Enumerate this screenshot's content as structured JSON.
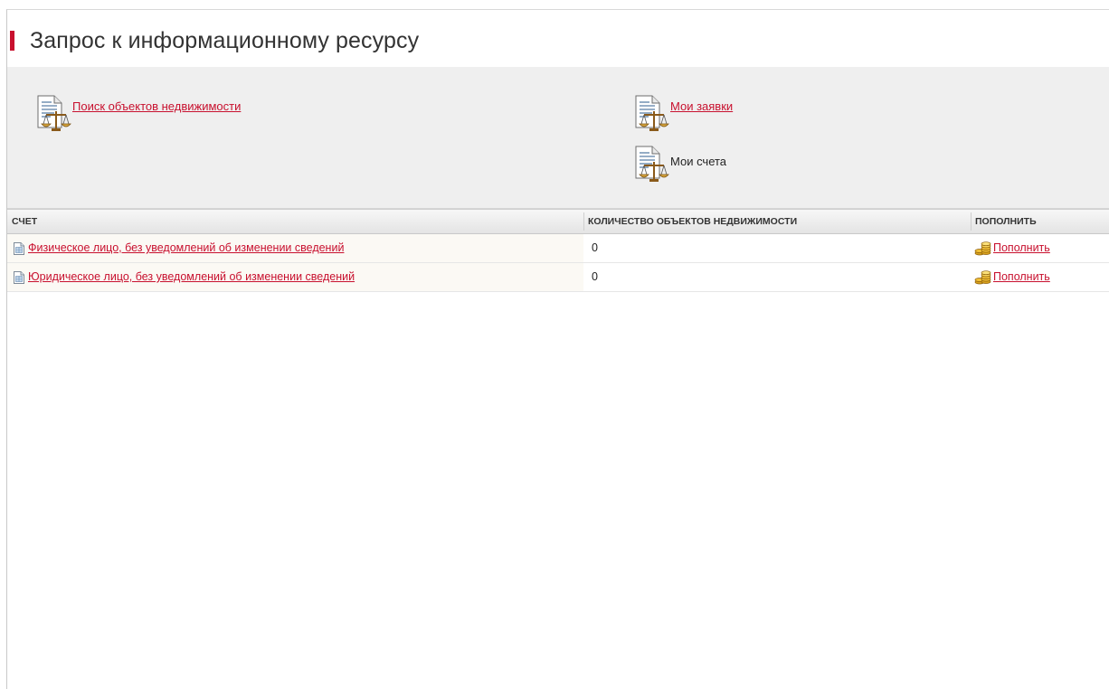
{
  "page": {
    "title": "Запрос к информационному ресурсу"
  },
  "nav": {
    "search_label": "Поиск объектов недвижимости",
    "requests_label": "Мои заявки",
    "accounts_label": "Мои счета"
  },
  "table": {
    "headers": {
      "account": "СЧЕТ",
      "count": "КОЛИЧЕСТВО ОБЪЕКТОВ НЕДВИЖИМОСТИ",
      "topup": "ПОПОЛНИТЬ"
    },
    "rows": [
      {
        "account": "Физическое лицо, без уведомлений об изменении сведений",
        "count": "0",
        "topup": "Пополнить"
      },
      {
        "account": "Юридическое лицо, без уведомлений об изменении сведений",
        "count": "0",
        "topup": "Пополнить"
      }
    ]
  },
  "colors": {
    "accent": "#c8102e",
    "nav_background": "#efefef",
    "row_background": "#fbf9f4"
  },
  "icons": {
    "nav": "document-scales-icon",
    "account": "document-icon",
    "topup": "coins-icon"
  }
}
